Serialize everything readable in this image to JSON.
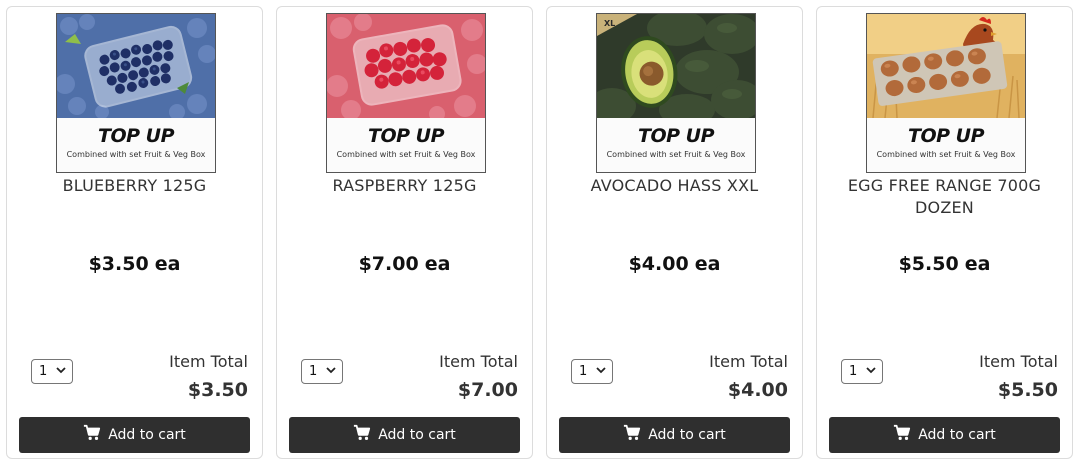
{
  "products": [
    {
      "badge_title": "TOP UP",
      "badge_subtitle": "Combined with set Fruit & Veg Box",
      "name": "BLUEBERRY 125G",
      "price": "$3.50",
      "unit": "ea",
      "quantity": "1",
      "item_total_label": "Item Total",
      "item_total": "$3.50",
      "button_label": "Add to cart",
      "image": "blueberry-punnet-photo"
    },
    {
      "badge_title": "TOP UP",
      "badge_subtitle": "Combined with set Fruit & Veg Box",
      "name": "RASPBERRY 125G",
      "price": "$7.00",
      "unit": "ea",
      "quantity": "1",
      "item_total_label": "Item Total",
      "item_total": "$7.00",
      "button_label": "Add to cart",
      "image": "raspberry-punnet-photo"
    },
    {
      "badge_title": "TOP UP",
      "badge_subtitle": "Combined with set Fruit & Veg Box",
      "name": "AVOCADO HASS XXL",
      "price": "$4.00",
      "unit": "ea",
      "quantity": "1",
      "item_total_label": "Item Total",
      "item_total": "$4.00",
      "button_label": "Add to cart",
      "image": "avocado-photo",
      "image_tag": "XL"
    },
    {
      "badge_title": "TOP UP",
      "badge_subtitle": "Combined with set Fruit & Veg Box",
      "name": "EGG FREE RANGE 700G DOZEN",
      "price": "$5.50",
      "unit": "ea",
      "quantity": "1",
      "item_total_label": "Item Total",
      "item_total": "$5.50",
      "button_label": "Add to cart",
      "image": "eggs-and-hen-photo"
    }
  ],
  "icons": {
    "cart": "shopping-cart-icon",
    "dropdown": "chevron-down-icon"
  },
  "colors": {
    "button_bg": "#2f2f2f",
    "button_text": "#ffffff",
    "card_border": "#dcdcdc"
  }
}
